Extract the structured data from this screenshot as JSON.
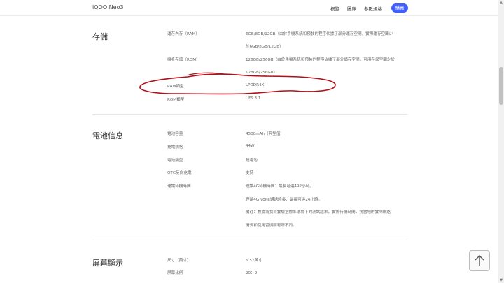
{
  "header": {
    "brand": "iQOO Neo3",
    "nav": [
      "概覽",
      "圖庫",
      "參數規格"
    ],
    "buy_label": "購買"
  },
  "storage": {
    "title": "存儲",
    "rows": [
      {
        "label": "運存內存（RAM）",
        "value_lines": [
          "6GB/8GB/12GB（由於手機系統和預裝的程序佔據了部分運存空間，實際運存空間少",
          "於6GB/8GB/12GB）"
        ]
      },
      {
        "label": "機身存儲（ROM）",
        "value_lines": [
          "128GB/256GB（由於手機系統和預裝的程序佔據了部分儲存空間，可用存儲空間少於",
          "128GB/256GB）"
        ]
      },
      {
        "label": "RAM類型",
        "value_lines": [
          "LPDDR4X"
        ]
      },
      {
        "label": "ROM類型",
        "value_lines": [
          "UFS 3.1"
        ]
      }
    ]
  },
  "battery": {
    "title": "電池信息",
    "rows": [
      {
        "label": "電池容量",
        "value": "4500mAh（典型值）"
      },
      {
        "label": "充電規格",
        "value": "44W"
      },
      {
        "label": "電池類型",
        "value": "鋰電池"
      },
      {
        "label": "OTG反向充電",
        "value": "支持"
      },
      {
        "label": "理論待機時間",
        "value": "理論4G待機時間：最長可達492小時。"
      }
    ],
    "extra_lines": [
      "理論4G Volte通話時長：最長可達24小時。",
      "備註：數據為我司實驗室標準環境下的測試結果，實際待機時間，視當地的實際網絡",
      "情況和使用習慣而有所不同。"
    ]
  },
  "display": {
    "title": "屏幕顯示",
    "rows": [
      {
        "label": "尺寸（英寸）",
        "value": "6.57英寸"
      },
      {
        "label": "屏幕比例",
        "value": "20：9"
      }
    ]
  },
  "colors": {
    "accent": "#415fff",
    "annotation": "#b0101a"
  },
  "icons": {
    "back_to_top": "arrow-up-icon"
  }
}
